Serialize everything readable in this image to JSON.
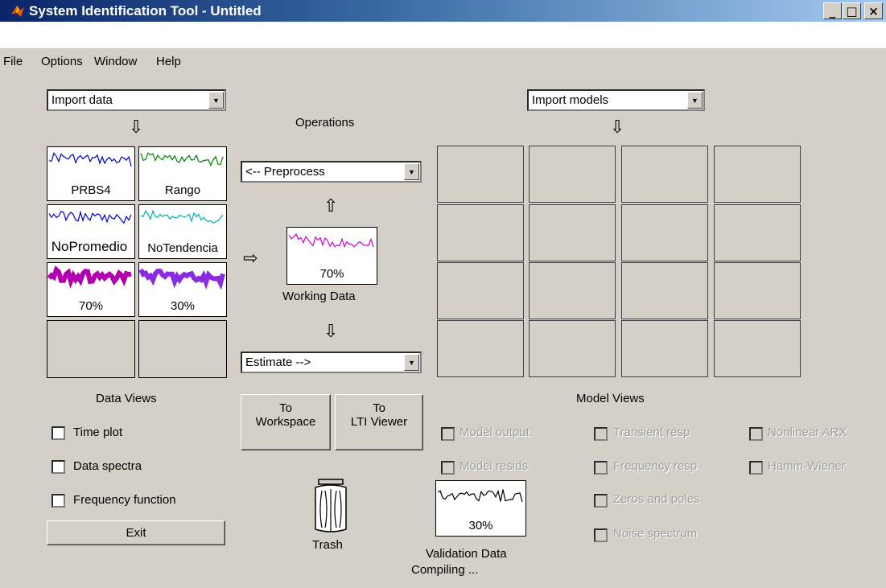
{
  "window": {
    "title": "System Identification Tool - Untitled",
    "min_label": "_",
    "max_label": "□",
    "close_label": "×"
  },
  "menu": [
    {
      "label": "File"
    },
    {
      "label": "Options"
    },
    {
      "label": "Window"
    },
    {
      "label": "Help"
    }
  ],
  "data_panel": {
    "import_combo": "Import data",
    "tiles": [
      {
        "label": "PRBS4",
        "color": "#0000cc"
      },
      {
        "label": "Rango",
        "color": "#008000"
      },
      {
        "label": "NoPromedio",
        "color": "#0000cc"
      },
      {
        "label": "NoTendencia",
        "color": "#00b0b0"
      },
      {
        "label": "70%",
        "color": "#b000b0"
      },
      {
        "label": "30%",
        "color": "#8a2be2"
      }
    ],
    "views_title": "Data Views",
    "checkboxes": [
      {
        "label": "Time plot"
      },
      {
        "label": "Data spectra"
      },
      {
        "label": "Frequency function"
      }
    ],
    "exit_label": "Exit"
  },
  "operations": {
    "title": "Operations",
    "preprocess_combo": "<-- Preprocess",
    "working_label": "70%",
    "working_caption": "Working Data",
    "working_color": "#cc00cc",
    "estimate_combo": "Estimate -->",
    "to_workspace": [
      "To",
      "Workspace"
    ],
    "to_lti": [
      "To",
      "LTI Viewer"
    ],
    "trash_label": "Trash",
    "validation_label": "30%",
    "validation_caption": "Validation Data",
    "status": "Compiling ..."
  },
  "model_panel": {
    "import_combo": "Import models",
    "views_title": "Model Views",
    "checkboxes": [
      {
        "label": "Model output"
      },
      {
        "label": "Model resids"
      },
      {
        "label": "Transient resp"
      },
      {
        "label": "Frequency resp"
      },
      {
        "label": "Zeros and poles"
      },
      {
        "label": "Noise spectrum"
      },
      {
        "label": "Nonlinear ARX"
      },
      {
        "label": "Hamm-Wiener"
      }
    ]
  }
}
